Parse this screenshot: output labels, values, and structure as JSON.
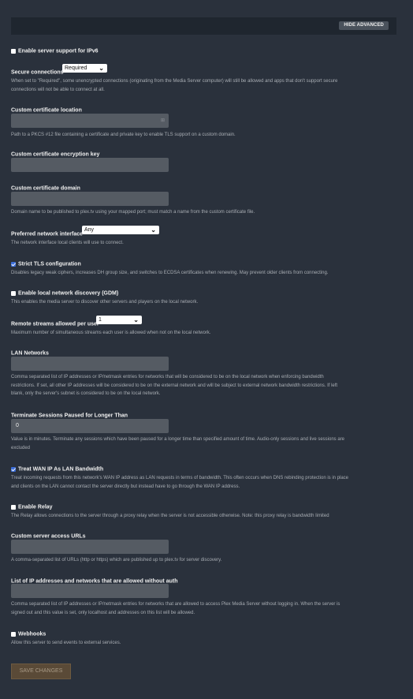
{
  "header": {
    "hide_advanced": "HIDE ADVANCED"
  },
  "ipv6": {
    "label": "Enable server support for IPv6",
    "checked": false
  },
  "secure_connections": {
    "label": "Secure connections",
    "value": "Required",
    "help_1": "When set to \"Required\", some unencrypted connections (originating from the Media Server computer) will still be allowed and apps that don't support secure",
    "help_2": "connections will not be able to connect at all."
  },
  "cert_location": {
    "label": "Custom certificate location",
    "icon": "folder-icon",
    "help": "Path to a PKCS #12 file containing a certificate and private key to enable TLS support on a custom domain."
  },
  "cert_key": {
    "label": "Custom certificate encryption key"
  },
  "cert_domain": {
    "label": "Custom certificate domain",
    "help": "Domain name to be published to plex.tv using your mapped port; must match a name from the custom certificate file."
  },
  "network_interface": {
    "label": "Preferred network interface",
    "value": "Any",
    "help": "The network interface local clients will use to connect."
  },
  "strict_tls": {
    "label": "Strict TLS configuration",
    "checked": true,
    "help": "Disables legacy weak ciphers, increases DH group size, and switches to ECDSA certificates when renewing. May prevent older clients from connecting."
  },
  "gdm": {
    "label": "Enable local network discovery (GDM)",
    "checked": false,
    "help": "This enables the media server to discover other servers and players on the local network."
  },
  "remote_streams": {
    "label": "Remote streams allowed per user",
    "value": "1",
    "help": "Maximum number of simultaneous streams each user is allowed when not on the local network."
  },
  "lan_networks": {
    "label": "LAN Networks",
    "help_1": "Comma separated list of IP addresses or IP/netmask entries for networks that will be considered to be on the local network when enforcing bandwidth",
    "help_2": "restrictions. If set, all other IP addresses will be considered to be on the external network and will be subject to external network bandwidth restrictions. If left",
    "help_3": "blank, only the server's subnet is considered to be on the local network."
  },
  "terminate_sessions": {
    "label": "Terminate Sessions Paused for Longer Than",
    "value": "0",
    "help_1": "Value is in minutes. Terminate any sessions which have been paused for a longer time than specified amount of time. Audio-only sessions and live sessions are",
    "help_2": "excluded"
  },
  "wan_ip": {
    "label": "Treat WAN IP As LAN Bandwidth",
    "checked": true,
    "help_1": "Treat incoming requests from this network's WAN IP address as LAN requests in terms of bandwidth. This often occurs when DNS rebinding protection is in place",
    "help_2": "and clients on the LAN cannot contact the server directly but instead have to go through the WAN IP address."
  },
  "relay": {
    "label": "Enable Relay",
    "checked": false,
    "help": "The Relay allows connections to the server through a proxy relay when the server is not accessible otherwise. Note: this proxy relay is bandwidth limited"
  },
  "access_urls": {
    "label": "Custom server access URLs",
    "help": "A comma-separated list of URLs (http or https) which are published up to plex.tv for server discovery."
  },
  "no_auth": {
    "label": "List of IP addresses and networks that are allowed without auth",
    "help_1": "Comma separated list of IP addresses or IP/netmask entries for networks that are allowed to access Plex Media Server without logging in. When the server is",
    "help_2": "signed out and this value is set, only localhost and addresses on this list will be allowed."
  },
  "webhooks": {
    "label": "Webhooks",
    "checked": false,
    "help": "Allow this server to send events to external services."
  },
  "footer": {
    "save": "SAVE CHANGES"
  }
}
